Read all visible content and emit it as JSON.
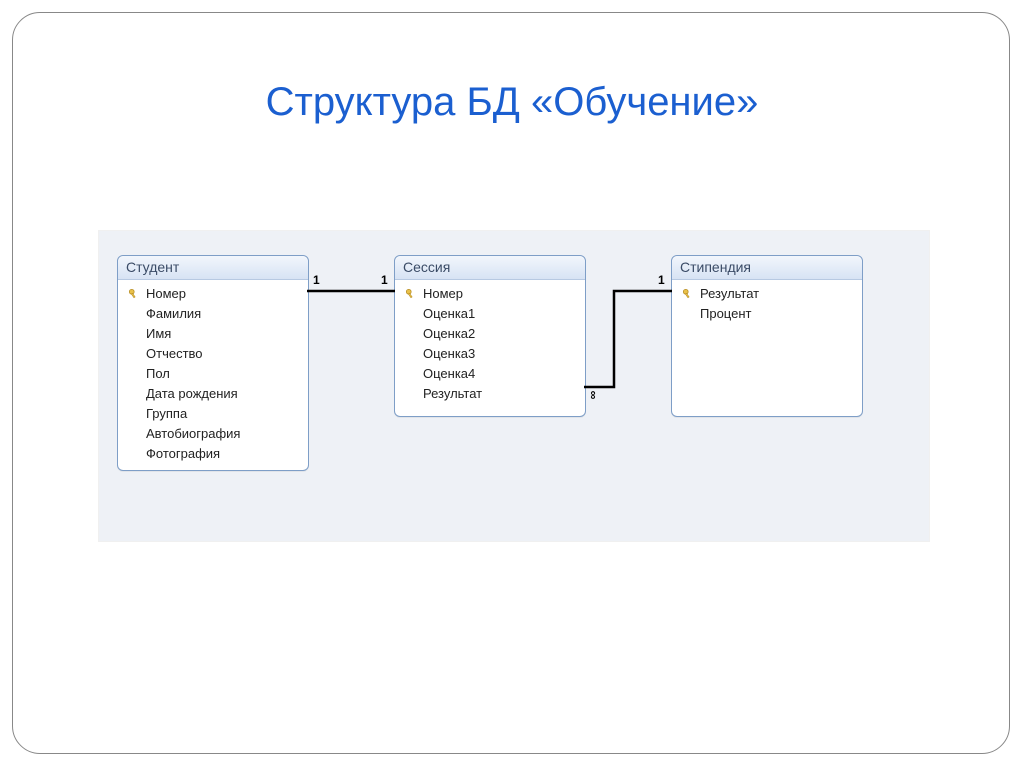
{
  "title": "Структура БД «Обучение»",
  "tables": {
    "t1": {
      "title": "Студент",
      "fields": [
        {
          "key": true,
          "name": "Номер"
        },
        {
          "key": false,
          "name": "Фамилия"
        },
        {
          "key": false,
          "name": "Имя"
        },
        {
          "key": false,
          "name": "Отчество"
        },
        {
          "key": false,
          "name": "Пол"
        },
        {
          "key": false,
          "name": "Дата рождения"
        },
        {
          "key": false,
          "name": "Группа"
        },
        {
          "key": false,
          "name": "Автобиография"
        },
        {
          "key": false,
          "name": "Фотография"
        }
      ]
    },
    "t2": {
      "title": "Сессия",
      "fields": [
        {
          "key": true,
          "name": "Номер"
        },
        {
          "key": false,
          "name": "Оценка1"
        },
        {
          "key": false,
          "name": "Оценка2"
        },
        {
          "key": false,
          "name": "Оценка3"
        },
        {
          "key": false,
          "name": "Оценка4"
        },
        {
          "key": false,
          "name": "Результат"
        }
      ]
    },
    "t3": {
      "title": "Стипендия",
      "fields": [
        {
          "key": true,
          "name": "Результат"
        },
        {
          "key": false,
          "name": "Процент"
        }
      ]
    }
  },
  "relations": {
    "r1_left": "1",
    "r1_right": "1",
    "r2_left": "∞",
    "r2_right": "1"
  }
}
